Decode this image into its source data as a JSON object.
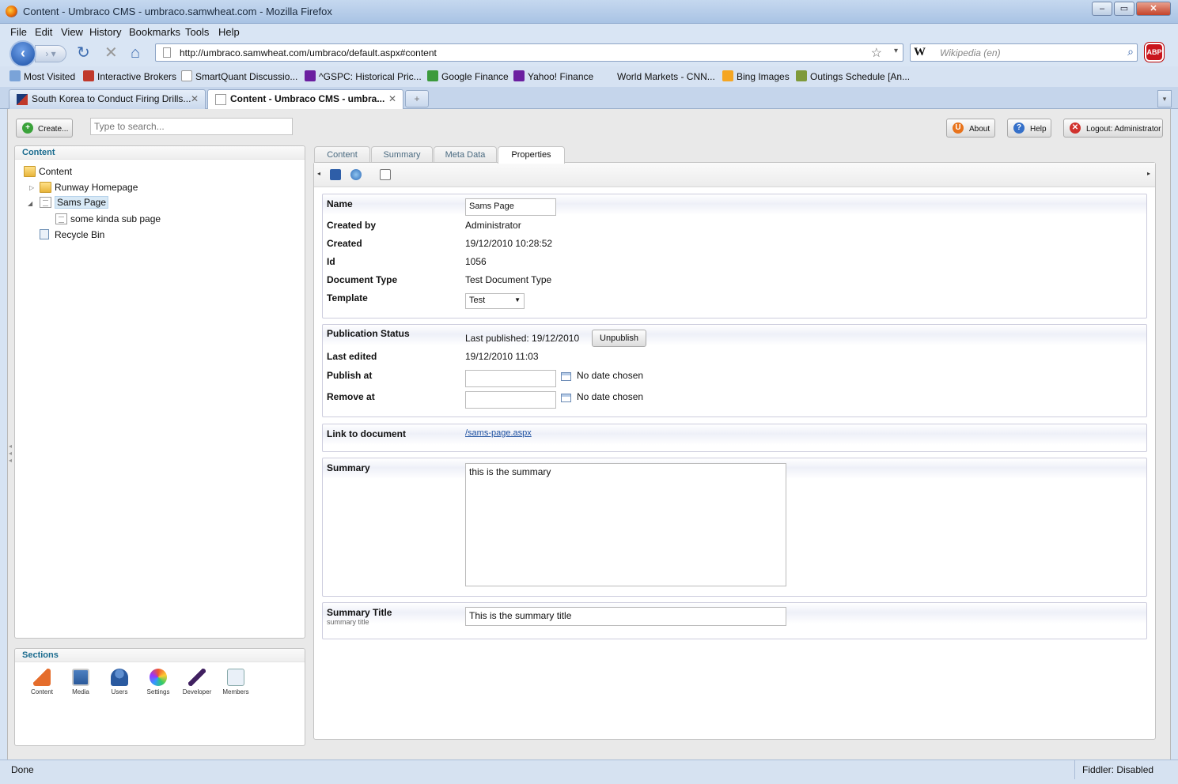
{
  "browser": {
    "window_title": "Content - Umbraco CMS - umbraco.samwheat.com - Mozilla Firefox",
    "menu": [
      "File",
      "Edit",
      "View",
      "History",
      "Bookmarks",
      "Tools",
      "Help"
    ],
    "url": "http://umbraco.samwheat.com/umbraco/default.aspx#content",
    "search_engine_glyph": "W",
    "search_placeholder": "Wikipedia (en)",
    "adblock_label": "ABP",
    "bookmarks": [
      "Most Visited",
      "Interactive Brokers",
      "SmartQuant Discussio...",
      "^GSPC: Historical Pric...",
      "Google Finance",
      "Yahoo! Finance",
      "World Markets - CNN...",
      "Bing Images",
      "Outings Schedule [An..."
    ],
    "tabs": [
      {
        "label": "South Korea to Conduct Firing Drills...",
        "active": false
      },
      {
        "label": "Content - Umbraco CMS - umbra...",
        "active": true
      }
    ],
    "new_tab_glyph": "+",
    "status_left": "Done",
    "status_right": "Fiddler: Disabled"
  },
  "umbraco": {
    "create_label": "Create...",
    "search_placeholder": "Type to search...",
    "about_label": "About",
    "help_label": "Help",
    "logout_label": "Logout: Administrator",
    "content_panel_title": "Content",
    "tree": {
      "root": "Content",
      "runway": "Runway Homepage",
      "sams": "Sams Page",
      "sub": "some kinda sub page",
      "recycle": "Recycle Bin"
    },
    "sections_title": "Sections",
    "sections": [
      "Content",
      "Media",
      "Users",
      "Settings",
      "Developer",
      "Members"
    ],
    "editor_tabs": [
      "Content",
      "Summary",
      "Meta Data",
      "Properties"
    ],
    "active_tab": "Properties",
    "props": {
      "name_label": "Name",
      "name_value": "Sams Page",
      "created_by_label": "Created by",
      "created_by_value": "Administrator",
      "created_label": "Created",
      "created_value": "19/12/2010 10:28:52",
      "id_label": "Id",
      "id_value": "1056",
      "doctype_label": "Document Type",
      "doctype_value": "Test Document Type",
      "template_label": "Template",
      "template_value": "Test"
    },
    "publication": {
      "status_label": "Publication Status",
      "last_published": "Last published: 19/12/2010",
      "unpublish_label": "Unpublish",
      "last_edited_label": "Last edited",
      "last_edited_value": "19/12/2010 11:03",
      "publish_at_label": "Publish at",
      "publish_at_value": "No date chosen",
      "remove_at_label": "Remove at",
      "remove_at_value": "No date chosen"
    },
    "link": {
      "label": "Link to document",
      "value": "/sams-page.aspx"
    },
    "summary": {
      "label": "Summary",
      "value": "this is the summary"
    },
    "summary_title": {
      "label": "Summary Title",
      "hint": "summary title",
      "value": "This is the summary title"
    }
  }
}
